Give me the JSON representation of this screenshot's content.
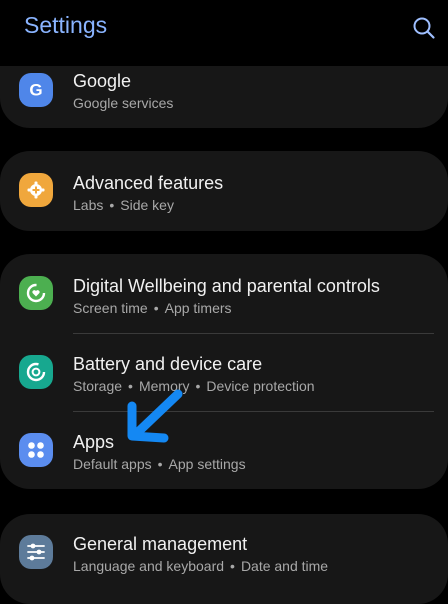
{
  "header": {
    "title": "Settings",
    "search_icon": "search-icon"
  },
  "items": [
    {
      "name": "google",
      "title": "Google",
      "subtitle": [
        "Google services"
      ],
      "icon": "google-icon",
      "icon_color": "#4f86e9"
    },
    {
      "name": "advanced-features",
      "title": "Advanced features",
      "subtitle": [
        "Labs",
        "Side key"
      ],
      "icon": "gear-plus-icon",
      "icon_color": "#f0a73c"
    },
    {
      "name": "digital-wellbeing",
      "title": "Digital Wellbeing and parental controls",
      "subtitle": [
        "Screen time",
        "App timers"
      ],
      "icon": "heart-ring-icon",
      "icon_color": "#4caf50"
    },
    {
      "name": "battery",
      "title": "Battery and device care",
      "subtitle": [
        "Storage",
        "Memory",
        "Device protection"
      ],
      "icon": "device-care-icon",
      "icon_color": "#17a88f"
    },
    {
      "name": "apps",
      "title": "Apps",
      "subtitle": [
        "Default apps",
        "App settings"
      ],
      "icon": "apps-grid-icon",
      "icon_color": "#5b8def"
    },
    {
      "name": "general-management",
      "title": "General management",
      "subtitle": [
        "Language and keyboard",
        "Date and time"
      ],
      "icon": "sliders-icon",
      "icon_color": "#5d7b9a"
    }
  ],
  "annotation": {
    "arrow_color": "#1488f3",
    "arrow_icon": "pointer-arrow-icon"
  }
}
